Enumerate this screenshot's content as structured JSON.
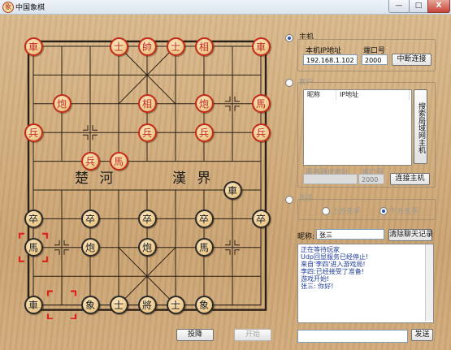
{
  "window": {
    "title": "中国象棋",
    "icon": "chess-piece-icon",
    "minimize": "—",
    "maximize": "□",
    "close": "X"
  },
  "board": {
    "river_left": "楚 河",
    "river_right": "漢 界",
    "colors": {
      "red": "#c22a1c",
      "black": "#1c1c1c",
      "selection": "#e0201a"
    },
    "pieces": [
      {
        "ch": "車",
        "side": "red",
        "file": 0,
        "rank": 0
      },
      {
        "ch": "士",
        "side": "red",
        "file": 3,
        "rank": 0
      },
      {
        "ch": "帥",
        "side": "red",
        "file": 4,
        "rank": 0
      },
      {
        "ch": "士",
        "side": "red",
        "file": 5,
        "rank": 0
      },
      {
        "ch": "相",
        "side": "red",
        "file": 6,
        "rank": 0
      },
      {
        "ch": "車",
        "side": "red",
        "file": 8,
        "rank": 0
      },
      {
        "ch": "炮",
        "side": "red",
        "file": 1,
        "rank": 2
      },
      {
        "ch": "相",
        "side": "red",
        "file": 4,
        "rank": 2
      },
      {
        "ch": "炮",
        "side": "red",
        "file": 6,
        "rank": 2
      },
      {
        "ch": "馬",
        "side": "red",
        "file": 8,
        "rank": 2
      },
      {
        "ch": "兵",
        "side": "red",
        "file": 0,
        "rank": 3
      },
      {
        "ch": "兵",
        "side": "red",
        "file": 4,
        "rank": 3
      },
      {
        "ch": "兵",
        "side": "red",
        "file": 6,
        "rank": 3
      },
      {
        "ch": "兵",
        "side": "red",
        "file": 8,
        "rank": 3
      },
      {
        "ch": "兵",
        "side": "red",
        "file": 2,
        "rank": 4
      },
      {
        "ch": "馬",
        "side": "red",
        "file": 3,
        "rank": 4
      },
      {
        "ch": "車",
        "side": "black",
        "file": 7,
        "rank": 5
      },
      {
        "ch": "卒",
        "side": "black",
        "file": 0,
        "rank": 6
      },
      {
        "ch": "卒",
        "side": "black",
        "file": 2,
        "rank": 6
      },
      {
        "ch": "卒",
        "side": "black",
        "file": 4,
        "rank": 6
      },
      {
        "ch": "卒",
        "side": "black",
        "file": 6,
        "rank": 6
      },
      {
        "ch": "卒",
        "side": "black",
        "file": 8,
        "rank": 6
      },
      {
        "ch": "馬",
        "side": "black",
        "file": 0,
        "rank": 7
      },
      {
        "ch": "炮",
        "side": "black",
        "file": 2,
        "rank": 7
      },
      {
        "ch": "炮",
        "side": "black",
        "file": 4,
        "rank": 7
      },
      {
        "ch": "馬",
        "side": "black",
        "file": 6,
        "rank": 7
      },
      {
        "ch": "車",
        "side": "black",
        "file": 0,
        "rank": 9
      },
      {
        "ch": "象",
        "side": "black",
        "file": 2,
        "rank": 9
      },
      {
        "ch": "士",
        "side": "black",
        "file": 3,
        "rank": 9
      },
      {
        "ch": "將",
        "side": "black",
        "file": 4,
        "rank": 9
      },
      {
        "ch": "士",
        "side": "black",
        "file": 5,
        "rank": 9
      },
      {
        "ch": "象",
        "side": "black",
        "file": 6,
        "rank": 9
      }
    ],
    "selection_marks": [
      {
        "file": 0,
        "rank": 7
      },
      {
        "file": 1,
        "rank": 9
      }
    ]
  },
  "buttons": {
    "surrender": "投降",
    "start": "开始"
  },
  "host": {
    "radio_label": "主机",
    "ip_label": "本机IP地址",
    "port_label": "端口号",
    "ip_value": "192.168.1.102",
    "port_value": "2000",
    "disconnect_button": "中断连接"
  },
  "client": {
    "radio_label": "客户",
    "list_headers": [
      "昵称",
      "IP地址"
    ],
    "search_button": "搜索局域网主机",
    "server_ip_label": "服务器IP地址",
    "port_label": "端口号",
    "port_value": "2000",
    "connect_button": "连接主机"
  },
  "first_move": {
    "group_label": "先手",
    "top_first": "上方先手",
    "bottom_first": "下方先手"
  },
  "chat": {
    "nickname_label": "昵称:",
    "nickname_value": "张三",
    "clear_button": "清除聊天记录",
    "messages": [
      "正在等待玩家",
      "Udp回显服务已经停止!",
      "来自'李四'进入游戏局!",
      "李四:已经接受了准备!",
      "游戏开始!",
      "张三: 你好!"
    ],
    "input_value": "",
    "send_button": "发送"
  }
}
